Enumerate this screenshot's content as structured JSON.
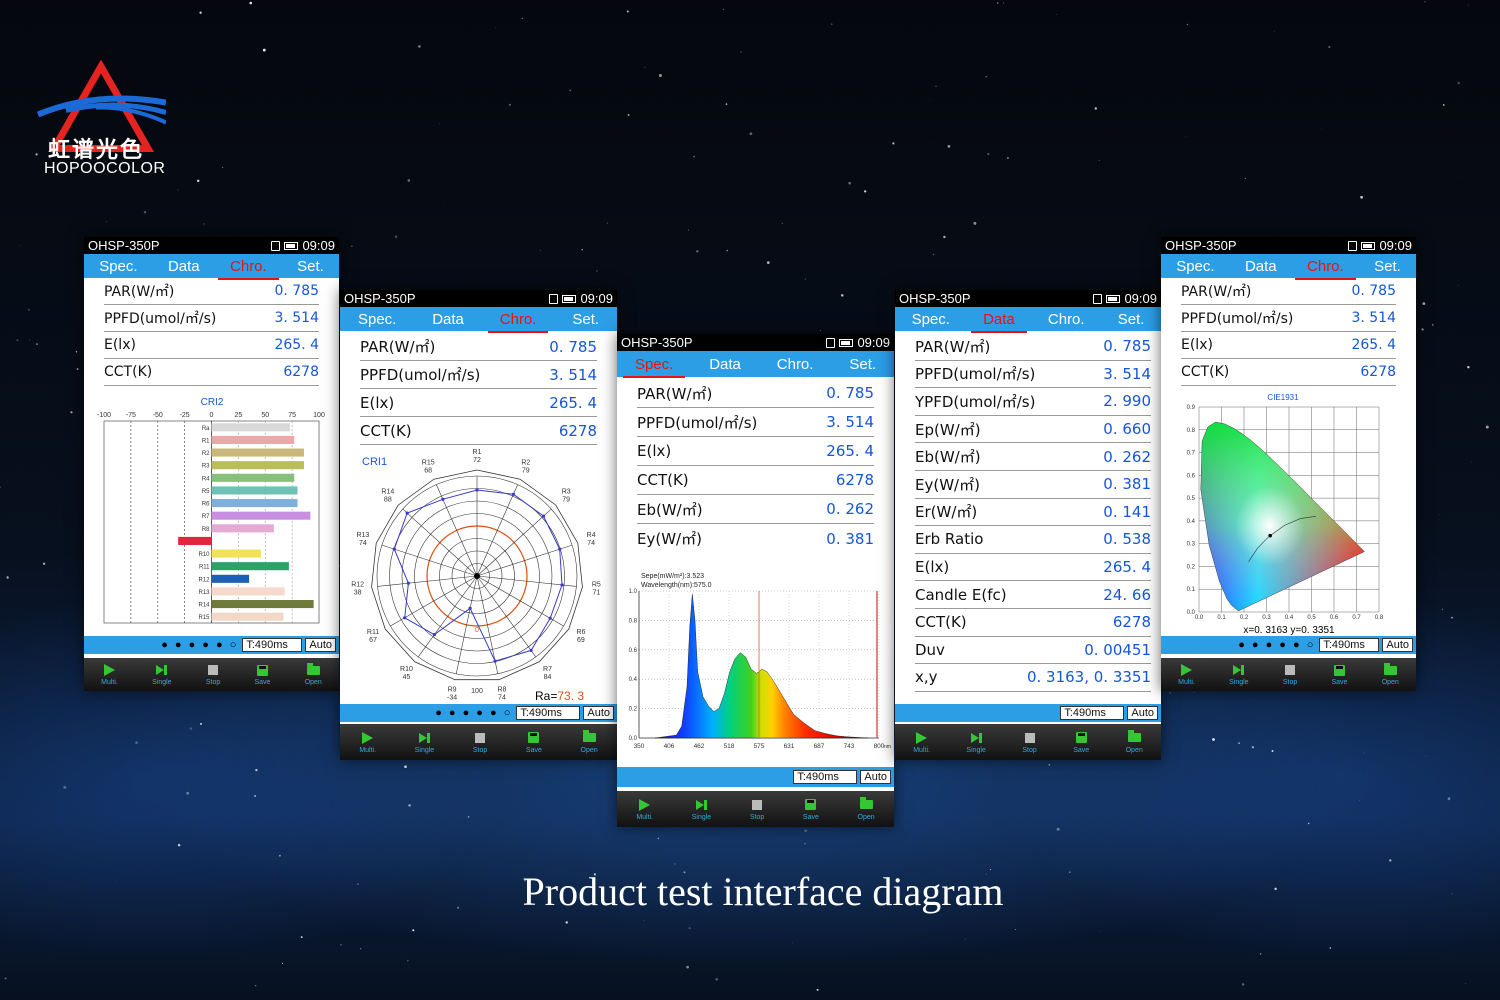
{
  "brand": {
    "name_cn": "虹谱光色",
    "name_en": "HOPOOCOLOR"
  },
  "caption": "Product test interface diagram",
  "device": {
    "model": "OHSP-350P",
    "time": "09:09",
    "tabs": [
      "Spec.",
      "Data",
      "Chro.",
      "Set."
    ],
    "integration": "T:490ms",
    "mode": "Auto",
    "dots": "● ● ● ● ● ○",
    "buttons": [
      "Multi.",
      "Single",
      "Stop",
      "Save",
      "Open"
    ]
  },
  "screens": {
    "s1": {
      "active_tab": "Chro.",
      "rows": [
        {
          "label": "PAR(W/㎡)",
          "value": "0. 785"
        },
        {
          "label": "PPFD(umol/㎡/s)",
          "value": "3. 514"
        },
        {
          "label": "E(lx)",
          "value": "265. 4"
        },
        {
          "label": "CCT(K)",
          "value": "6278"
        }
      ],
      "chart_title": "CRI2",
      "chart_data": {
        "type": "bar",
        "categories": [
          "Ra",
          "R1",
          "R2",
          "R3",
          "R4",
          "R5",
          "R6",
          "R7",
          "R8",
          "R9",
          "R10",
          "R11",
          "R12",
          "R13",
          "R14",
          "R15"
        ],
        "values": [
          73,
          77,
          86,
          86,
          77,
          80,
          80,
          92,
          58,
          -31,
          46,
          72,
          35,
          68,
          95,
          67
        ],
        "xlim": [
          -100,
          100
        ],
        "xticks": [
          "-100",
          "-75",
          "-50",
          "-25",
          "0",
          "25",
          "50",
          "75",
          "100"
        ],
        "colors": [
          "#d9d9d9",
          "#eaa8a8",
          "#c8b87a",
          "#b9bd5a",
          "#86c17c",
          "#6fc1b8",
          "#7fb0dc",
          "#c98fe0",
          "#e4a9d4",
          "#e4243c",
          "#f1e25a",
          "#2aa36a",
          "#1d5fb5",
          "#f4d9cc",
          "#6d7a3a",
          "#f3d8c8"
        ]
      }
    },
    "s2": {
      "active_tab": "Chro.",
      "rows": [
        {
          "label": "PAR(W/㎡)",
          "value": "0. 785"
        },
        {
          "label": "PPFD(umol/㎡/s)",
          "value": "3. 514"
        },
        {
          "label": "E(lx)",
          "value": "265. 4"
        },
        {
          "label": "CCT(K)",
          "value": "6278"
        }
      ],
      "chart_title": "CRI1",
      "ra_label": "Ra=",
      "ra_value": "73. 3",
      "chart_data": {
        "type": "radar",
        "categories": [
          "R1",
          "R2",
          "R3",
          "R4",
          "R5",
          "R6",
          "R7",
          "R8",
          "R9",
          "R10",
          "R11",
          "R12",
          "R13",
          "R14",
          "R15"
        ],
        "values": [
          72,
          79,
          79,
          74,
          71,
          69,
          84,
          74,
          -34,
          45,
          67,
          38,
          74,
          88,
          68
        ],
        "rlim": [
          -100,
          100
        ],
        "axis_labels": [
          "100",
          "0"
        ]
      }
    },
    "s3": {
      "active_tab": "Spec.",
      "rows": [
        {
          "label": "PAR(W/㎡)",
          "value": "0. 785"
        },
        {
          "label": "PPFD(umol/㎡/s)",
          "value": "3. 514"
        },
        {
          "label": "E(lx)",
          "value": "265. 4"
        },
        {
          "label": "CCT(K)",
          "value": "6278"
        },
        {
          "label": "Eb(W/㎡)",
          "value": "0. 262"
        },
        {
          "label": "Ey(W/㎡)",
          "value": "0. 381"
        }
      ],
      "readout1": "Sepe(mW/m²):3.523",
      "readout2": "Wavelength(nm):575.0",
      "chart_data": {
        "type": "area",
        "xlabel": "nm",
        "ylim": [
          0,
          1.0
        ],
        "yticks": [
          "1.0",
          "0.8",
          "0.6",
          "0.4",
          "0.2",
          "0.0"
        ],
        "xticks": [
          "350",
          "406",
          "462",
          "518",
          "575",
          "631",
          "687",
          "743",
          "800"
        ],
        "x": [
          380,
          420,
          430,
          440,
          445,
          450,
          455,
          460,
          470,
          480,
          490,
          500,
          510,
          520,
          530,
          540,
          550,
          560,
          570,
          575,
          580,
          590,
          600,
          610,
          620,
          630,
          640,
          660,
          680,
          700,
          720,
          740,
          760,
          780
        ],
        "y": [
          0,
          0.02,
          0.08,
          0.35,
          0.75,
          0.98,
          0.8,
          0.45,
          0.28,
          0.22,
          0.18,
          0.2,
          0.3,
          0.45,
          0.54,
          0.58,
          0.55,
          0.47,
          0.44,
          0.45,
          0.47,
          0.45,
          0.4,
          0.34,
          0.28,
          0.22,
          0.16,
          0.1,
          0.05,
          0.03,
          0.015,
          0.008,
          0.004,
          0.0
        ],
        "cursor": 575
      }
    },
    "s4": {
      "active_tab": "Data",
      "rows": [
        {
          "label": "PAR(W/㎡)",
          "value": "0. 785"
        },
        {
          "label": "PPFD(umol/㎡/s)",
          "value": "3. 514"
        },
        {
          "label": "YPFD(umol/㎡/s)",
          "value": "2. 990"
        },
        {
          "label": "Ep(W/㎡)",
          "value": "0. 660"
        },
        {
          "label": "Eb(W/㎡)",
          "value": "0. 262"
        },
        {
          "label": "Ey(W/㎡)",
          "value": "0. 381"
        },
        {
          "label": "Er(W/㎡)",
          "value": "0. 141"
        },
        {
          "label": "Erb Ratio",
          "value": "0. 538"
        },
        {
          "label": "E(lx)",
          "value": "265. 4"
        },
        {
          "label": "Candle E(fc)",
          "value": "24. 66"
        },
        {
          "label": "CCT(K)",
          "value": "6278"
        },
        {
          "label": "Duv",
          "value": "0. 00451"
        },
        {
          "label": "x,y",
          "value": "0. 3163, 0. 3351"
        }
      ]
    },
    "s5": {
      "active_tab": "Chro.",
      "rows": [
        {
          "label": "PAR(W/㎡)",
          "value": "0. 785"
        },
        {
          "label": "PPFD(umol/㎡/s)",
          "value": "3. 514"
        },
        {
          "label": "E(lx)",
          "value": "265. 4"
        },
        {
          "label": "CCT(K)",
          "value": "6278"
        }
      ],
      "chart_title": "CIE1931",
      "coords": "x=0. 3163  y=0. 3351",
      "chart_data": {
        "type": "scatter",
        "x": [
          0.3163
        ],
        "y": [
          0.3351
        ],
        "xlim": [
          0,
          0.8
        ],
        "ylim": [
          0,
          0.9
        ],
        "xticks": [
          "0.0",
          "0.1",
          "0.2",
          "0.3",
          "0.4",
          "0.5",
          "0.6",
          "0.7",
          "0.8"
        ],
        "yticks": [
          "0.9",
          "0.8",
          "0.7",
          "0.6",
          "0.5",
          "0.4",
          "0.3",
          "0.2",
          "0.1",
          "0.0"
        ]
      }
    }
  }
}
